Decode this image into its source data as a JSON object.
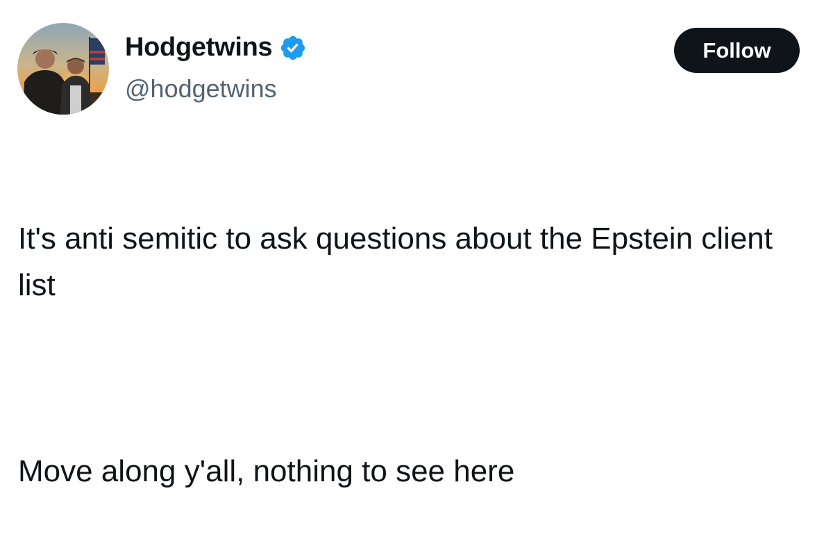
{
  "author": {
    "display_name": "Hodgetwins",
    "handle": "@hodgetwins",
    "verified_icon": "verified-badge-icon",
    "avatar": "profile-photo"
  },
  "actions": {
    "follow_label": "Follow"
  },
  "tweet": {
    "paragraphs": [
      "It's anti semitic to ask questions about the Epstein client list",
      "Move along y'all, nothing to see here"
    ]
  },
  "colors": {
    "text_primary": "#0f1419",
    "text_secondary": "#536471",
    "verified_blue": "#1d9bf0",
    "button_bg": "#0f1419"
  }
}
